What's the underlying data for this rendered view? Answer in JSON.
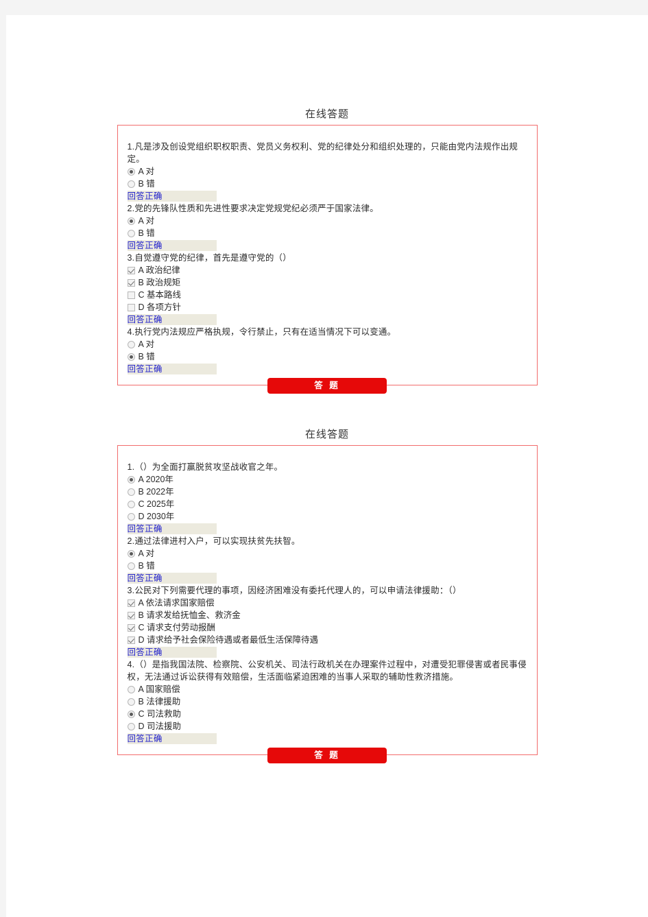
{
  "page": {
    "background_color": "#f4f4f4",
    "sheet_color": "#ffffff"
  },
  "theme": {
    "panel_border_color": "#f26c6c",
    "button_color": "#e60909",
    "badge_background": "#eceade",
    "badge_text_color": "#2222cc"
  },
  "blocks": [
    {
      "title": "在线答题",
      "submit_label": "答 题",
      "questions": [
        {
          "text": "1.凡是涉及创设党组织职权职责、党员义务权利、党的纪律处分和组织处理的，只能由党内法规作出规定。",
          "input_type": "radio",
          "options": [
            {
              "label": "A 对",
              "selected": true
            },
            {
              "label": "B 错",
              "selected": false
            }
          ],
          "result": "回答正确"
        },
        {
          "text": "2.党的先锋队性质和先进性要求决定党规党纪必须严于国家法律。",
          "input_type": "radio",
          "options": [
            {
              "label": "A 对",
              "selected": true
            },
            {
              "label": "B 错",
              "selected": false
            }
          ],
          "result": "回答正确"
        },
        {
          "text": "3.自觉遵守党的纪律，首先是遵守党的（）",
          "input_type": "checkbox",
          "options": [
            {
              "label": "A 政治纪律",
              "selected": true
            },
            {
              "label": "B 政治规矩",
              "selected": true
            },
            {
              "label": "C 基本路线",
              "selected": false
            },
            {
              "label": "D 各项方针",
              "selected": false
            }
          ],
          "result": "回答正确"
        },
        {
          "text": "4.执行党内法规应严格执规，令行禁止，只有在适当情况下可以变通。",
          "input_type": "radio",
          "options": [
            {
              "label": "A 对",
              "selected": false
            },
            {
              "label": "B 错",
              "selected": true
            }
          ],
          "result": "回答正确"
        }
      ]
    },
    {
      "title": "在线答题",
      "submit_label": "答 题",
      "questions": [
        {
          "text": "1.（）为全面打赢脱贫攻坚战收官之年。",
          "input_type": "radio",
          "options": [
            {
              "label": "A 2020年",
              "selected": true
            },
            {
              "label": "B 2022年",
              "selected": false
            },
            {
              "label": "C 2025年",
              "selected": false
            },
            {
              "label": "D 2030年",
              "selected": false
            }
          ],
          "result": "回答正确"
        },
        {
          "text": "2.通过法律进村入户，可以实现扶贫先扶智。",
          "input_type": "radio",
          "options": [
            {
              "label": "A 对",
              "selected": true
            },
            {
              "label": "B 错",
              "selected": false
            }
          ],
          "result": "回答正确"
        },
        {
          "text": "3.公民对下列需要代理的事项，因经济困难没有委托代理人的，可以申请法律援助：（）",
          "input_type": "checkbox",
          "options": [
            {
              "label": "A 依法请求国家赔偿",
              "selected": true
            },
            {
              "label": "B 请求发给抚恤金、救济金",
              "selected": true
            },
            {
              "label": "C 请求支付劳动报酬",
              "selected": true
            },
            {
              "label": "D 请求给予社会保险待遇或者最低生活保障待遇",
              "selected": true
            }
          ],
          "result": "回答正确"
        },
        {
          "text": "4.（）是指我国法院、检察院、公安机关、司法行政机关在办理案件过程中，对遭受犯罪侵害或者民事侵权，无法通过诉讼获得有效赔偿，生活面临紧迫困难的当事人采取的辅助性救济措施。",
          "input_type": "radio",
          "options": [
            {
              "label": "A 国家赔偿",
              "selected": false
            },
            {
              "label": "B 法律援助",
              "selected": false
            },
            {
              "label": "C 司法救助",
              "selected": true
            },
            {
              "label": "D 司法援助",
              "selected": false
            }
          ],
          "result": "回答正确"
        }
      ]
    }
  ]
}
